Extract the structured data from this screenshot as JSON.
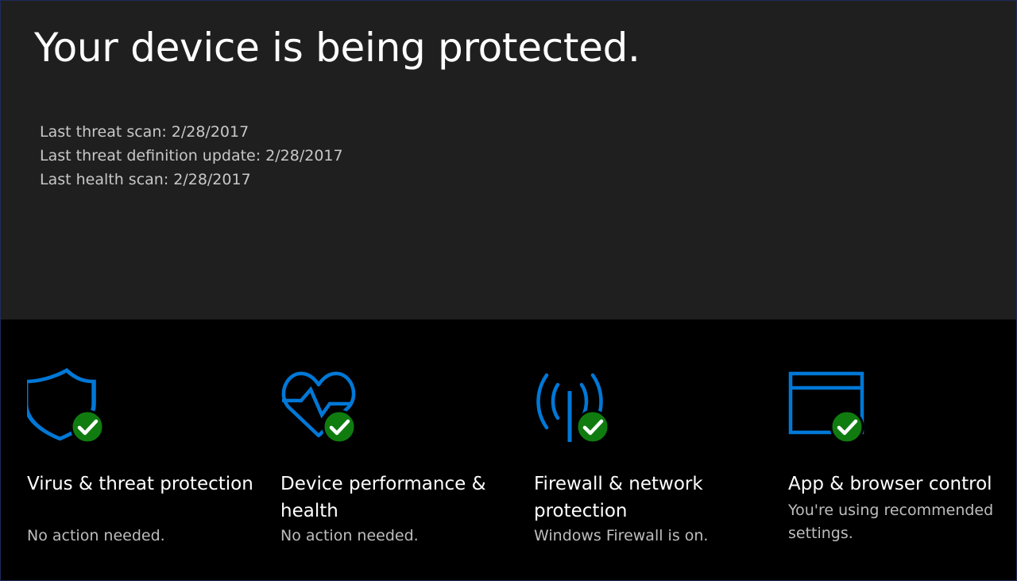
{
  "hero": {
    "title": "Your device is being protected.",
    "scans": [
      {
        "label": "Last threat scan:",
        "value": "2/28/2017"
      },
      {
        "label": "Last threat definition update:",
        "value": "2/28/2017"
      },
      {
        "label": "Last health scan:",
        "value": "2/28/2017"
      }
    ]
  },
  "colors": {
    "accent": "#0078d7",
    "check_badge": "#107c10",
    "hero_background": "#1f1f1f",
    "tiles_background": "#000000"
  },
  "tiles": [
    {
      "icon": "shield-icon",
      "title": "Virus & threat protection",
      "status": "No action needed."
    },
    {
      "icon": "heart-health-icon",
      "title": "Device performance & health",
      "status": "No action needed."
    },
    {
      "icon": "firewall-antenna-icon",
      "title": "Firewall & network protection",
      "status": "Windows Firewall is on."
    },
    {
      "icon": "app-browser-window-icon",
      "title": "App & browser control",
      "status": "You're using recommended settings."
    }
  ]
}
